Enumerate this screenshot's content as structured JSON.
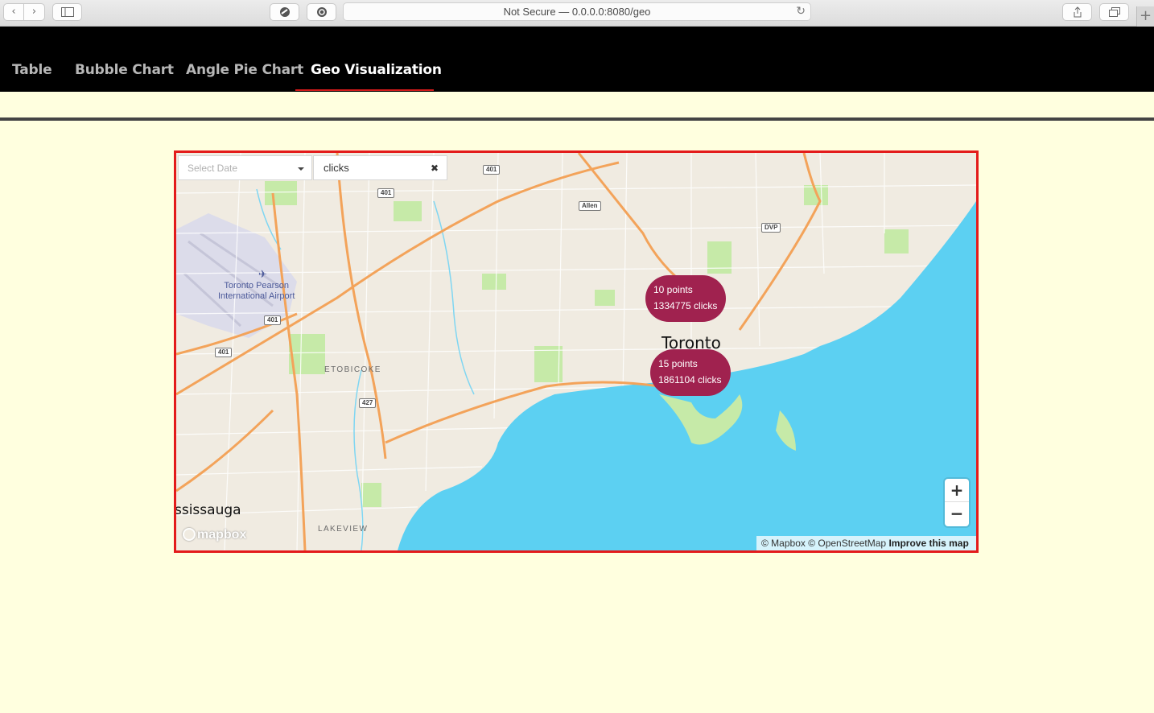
{
  "browser": {
    "url": "Not Secure — 0.0.0.0:8080/geo",
    "back_glyph": "‹",
    "forward_glyph": "›",
    "new_tab_glyph": "+"
  },
  "tabs": [
    {
      "label": "Table",
      "active": false
    },
    {
      "label": "Bubble Chart",
      "active": false
    },
    {
      "label": "Angle Pie Chart",
      "active": false
    },
    {
      "label": "Geo Visualization",
      "active": true
    }
  ],
  "colors": {
    "page_background": "#ffffdf",
    "header": "#000000",
    "active_tab_underline": "#d41a1a",
    "map_border": "#e31b1b",
    "cluster": "#a0224f",
    "water": "#5cd0f2"
  },
  "filters": {
    "date_placeholder": "Select Date",
    "metric_value": "clicks",
    "clear_glyph": "✖"
  },
  "map": {
    "clusters": [
      {
        "points": "10 points",
        "clicks": "1334775 clicks"
      },
      {
        "points": "15 points",
        "clicks": "1861104 clicks"
      }
    ],
    "labels": {
      "city": "Toronto",
      "airport_line1": "Toronto Pearson",
      "airport_line2": "International Airport",
      "etobicoke": "ETOBICOKE",
      "lakeview": "LAKEVIEW",
      "mississauga": "ssissauga"
    },
    "road_shields": [
      "401",
      "401",
      "401",
      "401",
      "427",
      "Allen",
      "DVP"
    ],
    "logo": "mapbox",
    "attribution": "© Mapbox © OpenStreetMap",
    "improve": "Improve this map",
    "zoom_in": "+",
    "zoom_out": "−"
  }
}
